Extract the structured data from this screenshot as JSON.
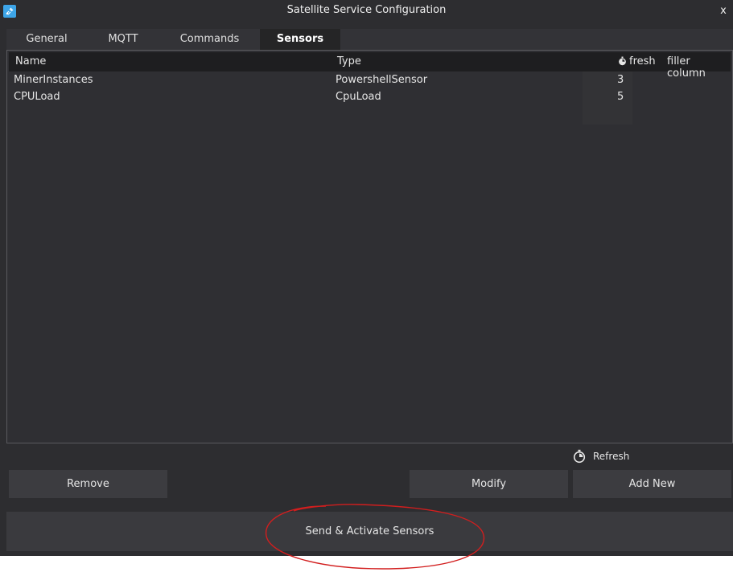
{
  "window": {
    "title": "Satellite Service Configuration",
    "close_glyph": "x"
  },
  "tabs": [
    {
      "label": "General",
      "active": false
    },
    {
      "label": "MQTT",
      "active": false
    },
    {
      "label": "Commands",
      "active": false
    },
    {
      "label": "Sensors",
      "active": true
    }
  ],
  "sensors_table": {
    "columns": {
      "name": "Name",
      "type": "Type",
      "fresh": "fresh",
      "filler": "filler column"
    },
    "rows": [
      {
        "name": "MinerInstances",
        "type": "PowershellSensor",
        "fresh": "3"
      },
      {
        "name": "CPULoad",
        "type": "CpuLoad",
        "fresh": "5"
      }
    ]
  },
  "actions": {
    "refresh_label": "Refresh",
    "remove_label": "Remove",
    "modify_label": "Modify",
    "add_new_label": "Add New",
    "send_activate_label": "Send & Activate Sensors"
  },
  "icons": {
    "app": "satellite-app-icon",
    "column_fresh": "stopwatch-icon",
    "refresh": "stopwatch-icon"
  },
  "colors": {
    "background": "#2d2d30",
    "header": "#1e1e20",
    "button": "#3c3c40",
    "annotation": "#d21e1e",
    "app_icon": "#3da5e8"
  }
}
